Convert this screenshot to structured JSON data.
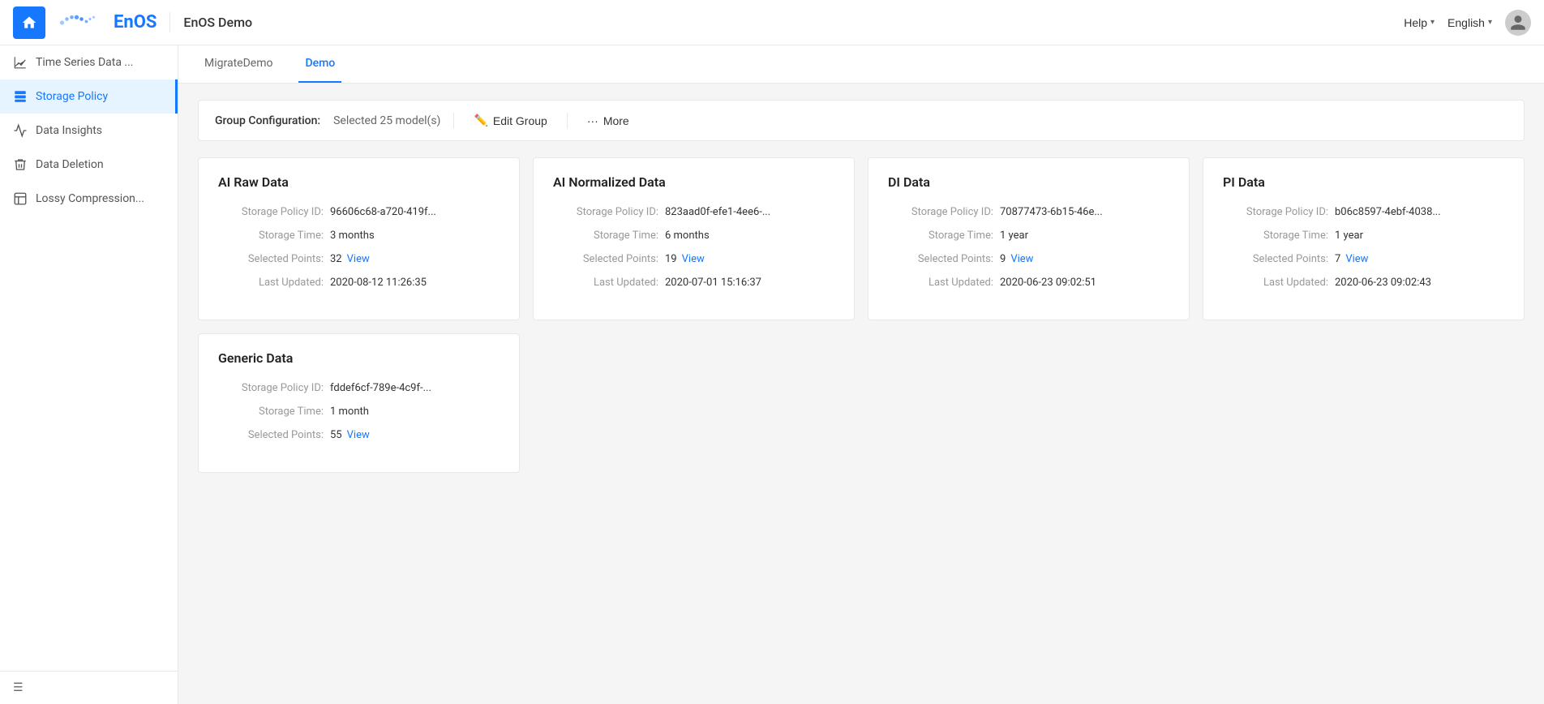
{
  "header": {
    "app_title": "EnOS Demo",
    "help_label": "Help",
    "language_label": "English",
    "logo_text": "EnOS"
  },
  "sidebar": {
    "items": [
      {
        "id": "time-series",
        "label": "Time Series Data ...",
        "active": false
      },
      {
        "id": "storage-policy",
        "label": "Storage Policy",
        "active": true
      },
      {
        "id": "data-insights",
        "label": "Data Insights",
        "active": false
      },
      {
        "id": "data-deletion",
        "label": "Data Deletion",
        "active": false
      },
      {
        "id": "lossy-compression",
        "label": "Lossy Compression...",
        "active": false
      }
    ]
  },
  "tabs": [
    {
      "id": "migrate-demo",
      "label": "MigrateDemo",
      "active": false
    },
    {
      "id": "demo",
      "label": "Demo",
      "active": true
    }
  ],
  "group_config": {
    "label": "Group Configuration:",
    "value": "Selected 25 model(s)",
    "edit_group_label": "Edit Group",
    "more_label": "More"
  },
  "cards": [
    {
      "title": "AI Raw Data",
      "policy_id_label": "Storage Policy ID:",
      "policy_id_value": "96606c68-a720-419f...",
      "storage_time_label": "Storage Time:",
      "storage_time_value": "3 months",
      "selected_points_label": "Selected Points:",
      "selected_points_value": "32",
      "view_label": "View",
      "last_updated_label": "Last Updated:",
      "last_updated_value": "2020-08-12 11:26:35"
    },
    {
      "title": "AI Normalized Data",
      "policy_id_label": "Storage Policy ID:",
      "policy_id_value": "823aad0f-efe1-4ee6-...",
      "storage_time_label": "Storage Time:",
      "storage_time_value": "6 months",
      "selected_points_label": "Selected Points:",
      "selected_points_value": "19",
      "view_label": "View",
      "last_updated_label": "Last Updated:",
      "last_updated_value": "2020-07-01 15:16:37"
    },
    {
      "title": "DI Data",
      "policy_id_label": "Storage Policy ID:",
      "policy_id_value": "70877473-6b15-46e...",
      "storage_time_label": "Storage Time:",
      "storage_time_value": "1 year",
      "selected_points_label": "Selected Points:",
      "selected_points_value": "9",
      "view_label": "View",
      "last_updated_label": "Last Updated:",
      "last_updated_value": "2020-06-23 09:02:51"
    },
    {
      "title": "PI Data",
      "policy_id_label": "Storage Policy ID:",
      "policy_id_value": "b06c8597-4ebf-4038...",
      "storage_time_label": "Storage Time:",
      "storage_time_value": "1 year",
      "selected_points_label": "Selected Points:",
      "selected_points_value": "7",
      "view_label": "View",
      "last_updated_label": "Last Updated:",
      "last_updated_value": "2020-06-23 09:02:43"
    }
  ],
  "cards_row2": [
    {
      "title": "Generic Data",
      "policy_id_label": "Storage Policy ID:",
      "policy_id_value": "fddef6cf-789e-4c9f-...",
      "storage_time_label": "Storage Time:",
      "storage_time_value": "1 month",
      "selected_points_label": "Selected Points:",
      "selected_points_value": "55",
      "view_label": "View"
    }
  ]
}
